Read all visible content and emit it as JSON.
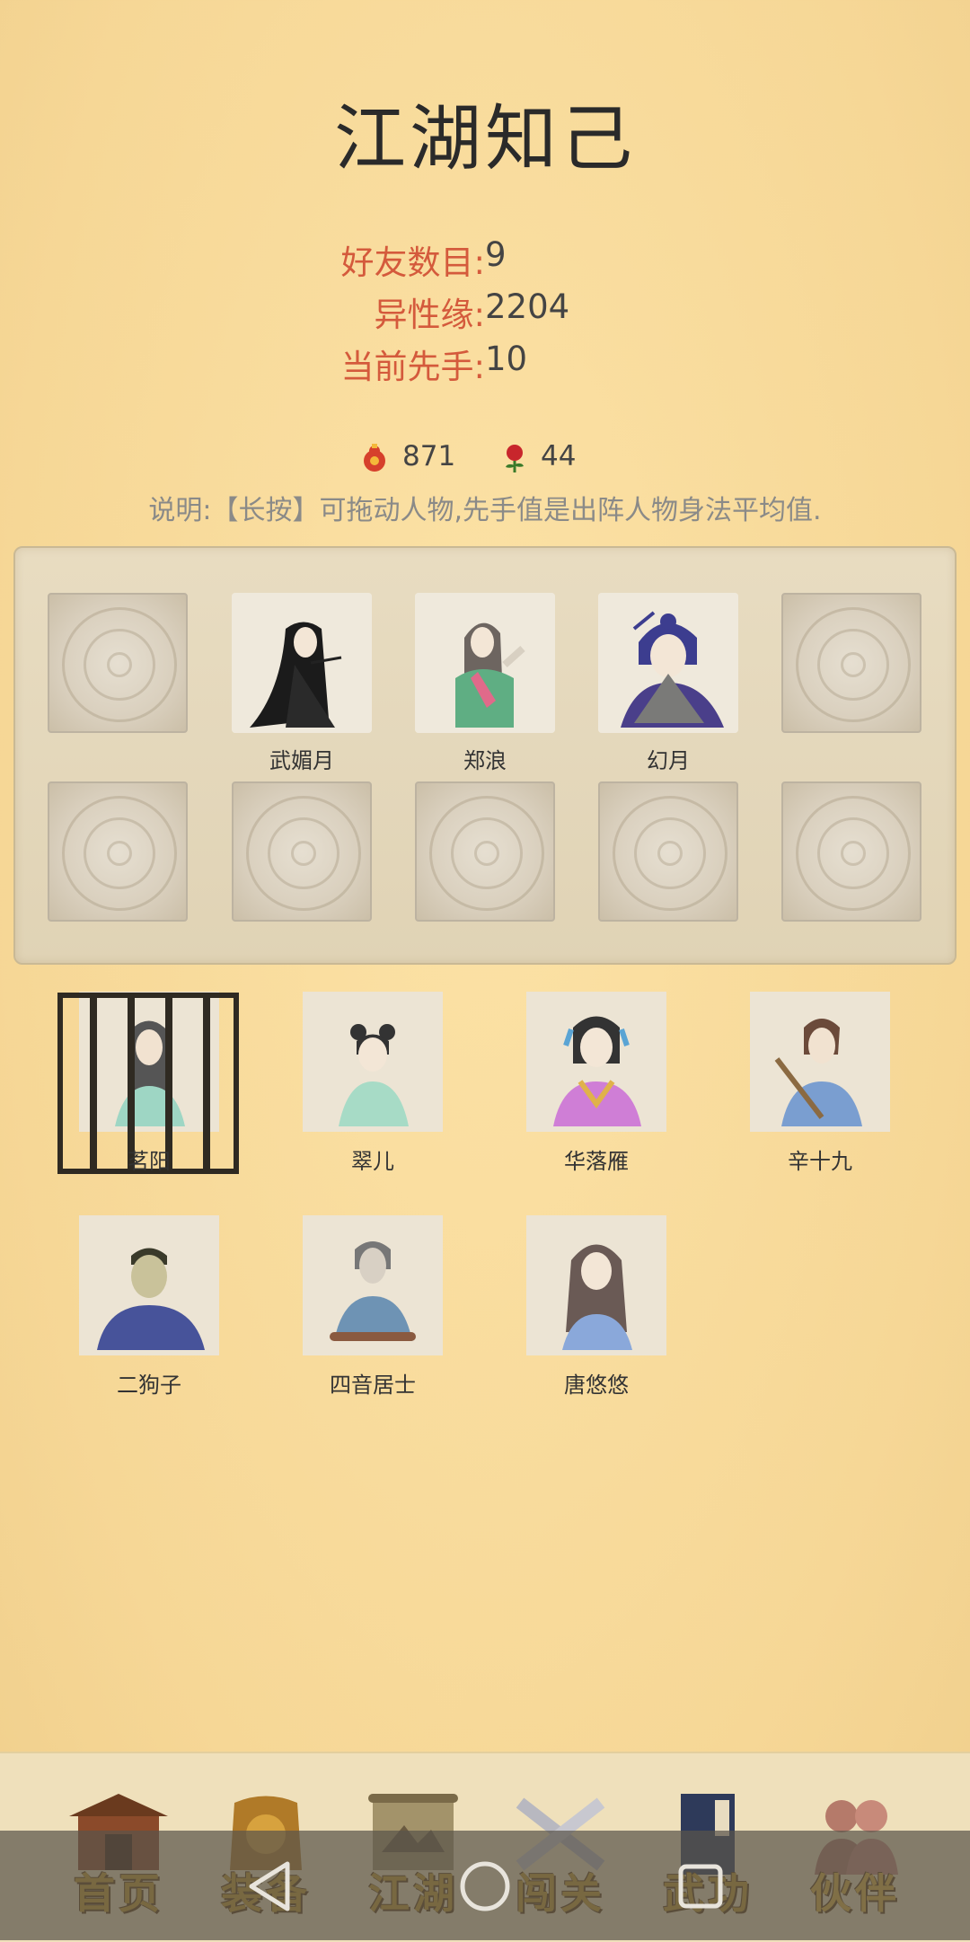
{
  "title": "江湖知己",
  "stats": [
    {
      "label": "好友数目:",
      "value": "9"
    },
    {
      "label": "异性缘:",
      "value": "2204"
    },
    {
      "label": "当前先手:",
      "value": "10"
    }
  ],
  "resources": {
    "gourd": "871",
    "rose": "44"
  },
  "note": "说明:【长按】可拖动人物,先手值是出阵人物身法平均值.",
  "team": {
    "slots": [
      "",
      "武媚月",
      "郑浪",
      "幻月",
      "",
      "",
      "",
      "",
      "",
      ""
    ]
  },
  "friends": [
    {
      "name": "茗阳"
    },
    {
      "name": "翠儿"
    },
    {
      "name": "华落雁"
    },
    {
      "name": "辛十九"
    },
    {
      "name": "二狗子"
    },
    {
      "name": "四音居士"
    },
    {
      "name": "唐悠悠"
    }
  ],
  "nav": [
    {
      "label": "首页"
    },
    {
      "label": "装备"
    },
    {
      "label": "江湖"
    },
    {
      "label": "闯关"
    },
    {
      "label": "武功"
    },
    {
      "label": "伙伴"
    }
  ],
  "icons": {
    "gourd": "gourd-icon",
    "rose": "rose-icon",
    "back": "back-triangle-icon",
    "home": "home-circle-icon",
    "recents": "recents-square-icon"
  },
  "colors": {
    "accent": "#d45a3c",
    "background": "#f6d796",
    "nav_label": "#c49a28"
  }
}
